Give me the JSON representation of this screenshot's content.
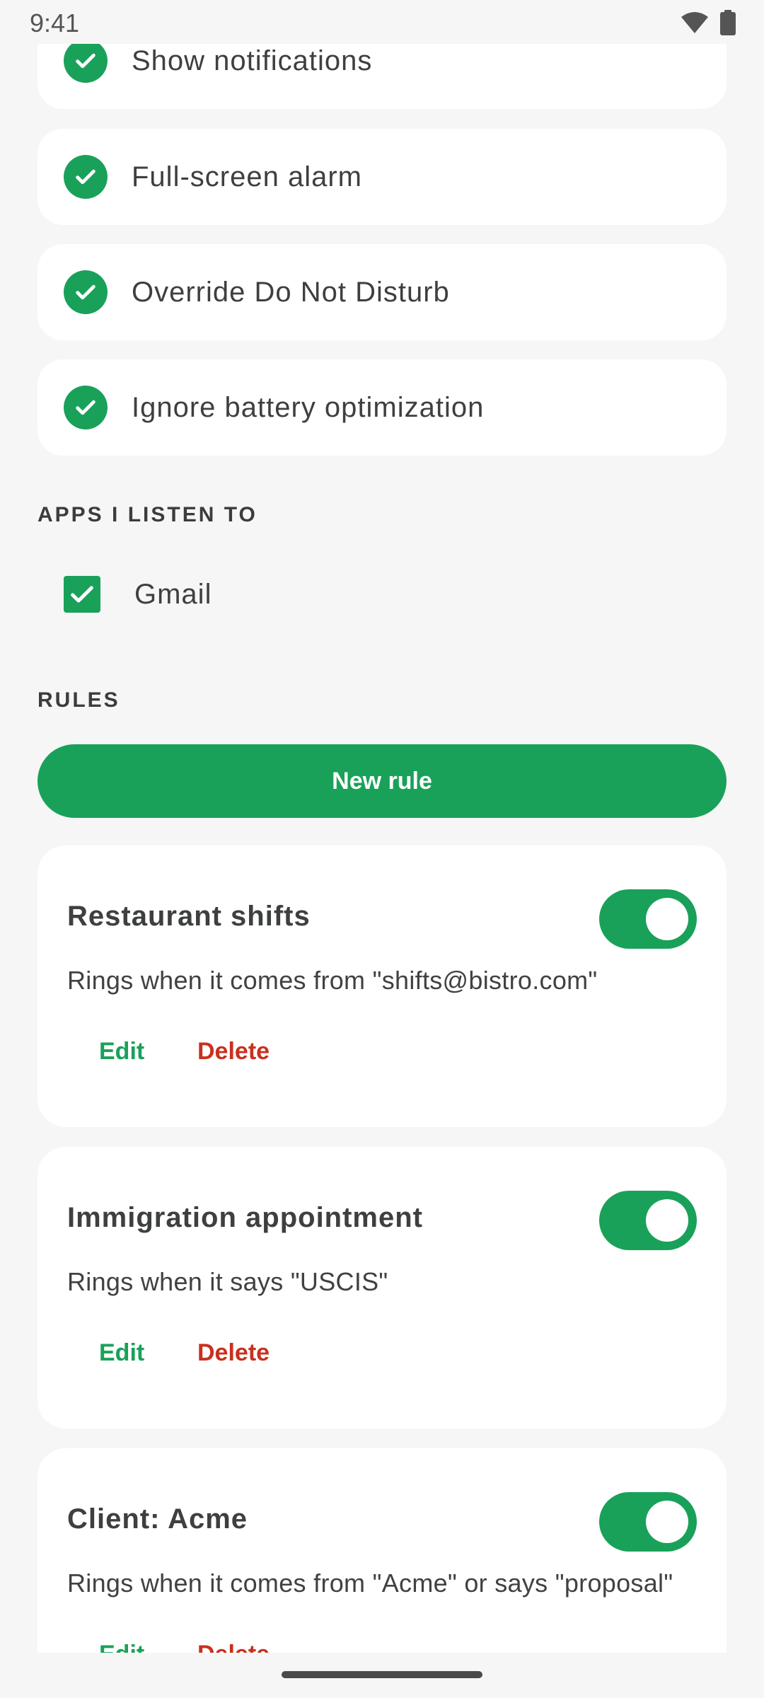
{
  "status_bar": {
    "time": "9:41"
  },
  "permissions": [
    {
      "label": "Show notifications",
      "checked": true
    },
    {
      "label": "Full-screen alarm",
      "checked": true
    },
    {
      "label": "Override Do Not Disturb",
      "checked": true
    },
    {
      "label": "Ignore battery optimization",
      "checked": true
    }
  ],
  "apps_section": {
    "header": "APPS I LISTEN TO",
    "apps": [
      {
        "label": "Gmail",
        "checked": true
      }
    ]
  },
  "rules_section": {
    "header": "RULES",
    "new_rule_label": "New rule",
    "rules": [
      {
        "title": "Restaurant shifts",
        "description": "Rings when it comes from \"shifts@bistro.com\"",
        "edit_label": "Edit",
        "delete_label": "Delete",
        "enabled": true
      },
      {
        "title": "Immigration appointment",
        "description": "Rings when it says \"USCIS\"",
        "edit_label": "Edit",
        "delete_label": "Delete",
        "enabled": true
      },
      {
        "title": "Client: Acme",
        "description": "Rings when it comes from \"Acme\" or says \"proposal\"",
        "edit_label": "Edit",
        "delete_label": "Delete",
        "enabled": true
      }
    ]
  },
  "colors": {
    "accent": "#19a15a",
    "danger": "#c9301f",
    "background": "#f5f6f5",
    "card": "#ffffff"
  }
}
